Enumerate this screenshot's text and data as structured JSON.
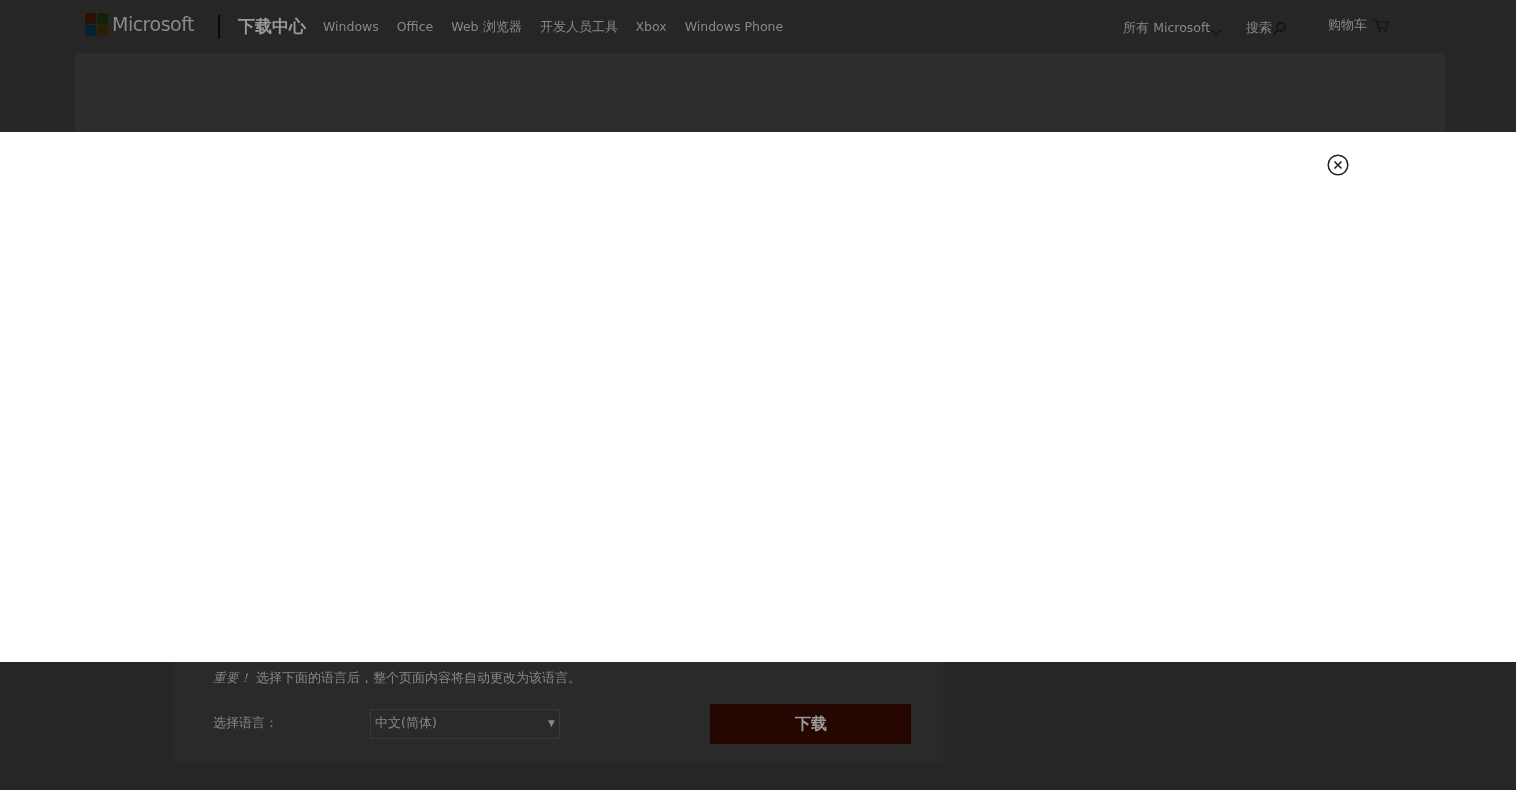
{
  "header": {
    "logo": "Microsoft",
    "site_title": "下载中心",
    "nav": [
      "Windows",
      "Office",
      "Web 浏览器",
      "开发人员工具",
      "Xbox",
      "Windows Phone"
    ],
    "all_microsoft": "所有 Microsoft",
    "search": "搜索",
    "cart": "购物车"
  },
  "download_panel": {
    "notice": "*重要！* 选择下面的语言后，整个页面内容将自动更改为该语言。",
    "language_label": "选择语言：",
    "language_value": "中文(简体)",
    "select_arrow": "▼",
    "download_button": "下载"
  },
  "modal": {
    "open": true
  }
}
